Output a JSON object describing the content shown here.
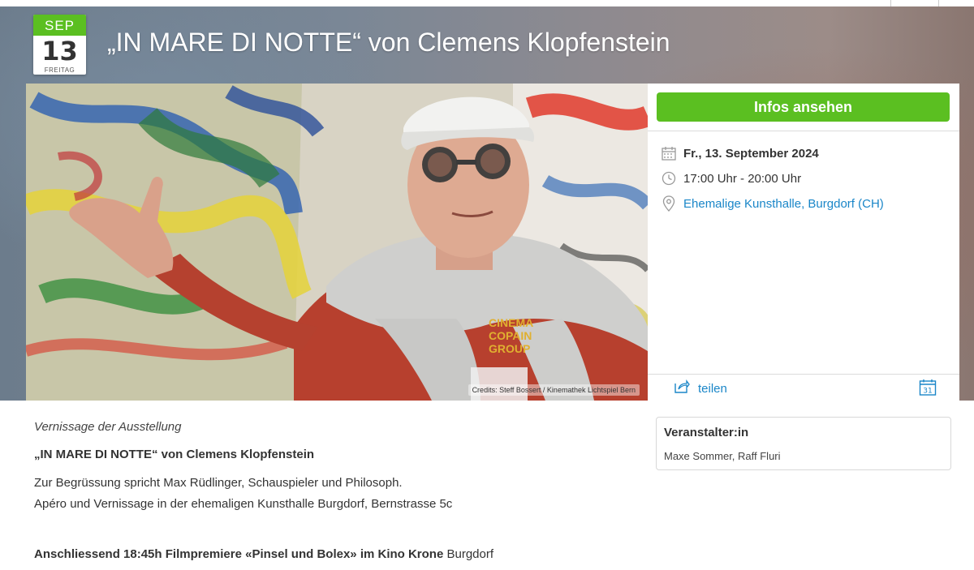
{
  "event": {
    "month": "SEP",
    "day": "13",
    "weekday": "FREITAG",
    "title": "„IN MARE DI NOTTE“ von Clemens Klopfenstein"
  },
  "photo": {
    "credit": "Credits: Steff Bossert / Kinemathek Lichtspiel Bern",
    "shirt_text": "CINEMA COPAIN GROUP"
  },
  "panel": {
    "info_button": "Infos ansehen",
    "date": "Fr., 13. September 2024",
    "time": "17:00 Uhr - 20:00 Uhr",
    "location": "Ehemalige Kunsthalle, Burgdorf (CH)",
    "share_label": "teilen",
    "calendar_icon_num": "31"
  },
  "description": {
    "subtitle": "Vernissage der Ausstellung",
    "title": "„IN MARE DI NOTTE“ von Clemens Klopfenstein",
    "line1": "Zur Begrüssung spricht Max Rüdlinger, Schauspieler und Philosoph.",
    "line2": "Apéro und Vernissage in der ehemaligen Kunsthalle Burgdorf, Bernstrasse 5c",
    "line3_bold": "Anschliessend 18:45h Filmpremiere «Pinsel und Bolex» im Kino Krone",
    "line3_rest": " Burgdorf"
  },
  "organizer": {
    "heading": "Veranstalter:in",
    "names": "Maxe Sommer, Raff Fluri"
  },
  "colors": {
    "accent_green": "#5bbf21",
    "link_blue": "#1a86c8"
  }
}
